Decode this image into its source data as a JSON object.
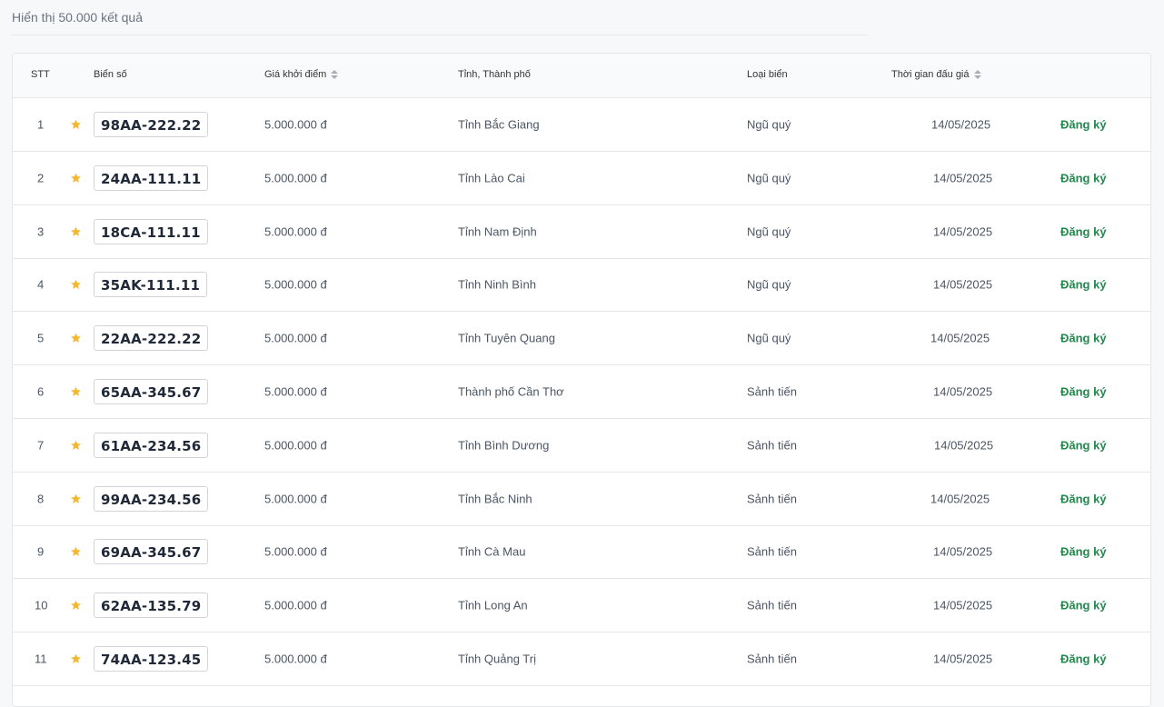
{
  "results": {
    "summary": "Hiển thị 50.000 kết quả"
  },
  "table": {
    "headers": {
      "stt": "STT",
      "plate": "Biển số",
      "price": "Giá khởi điểm",
      "province": "Tỉnh, Thành phố",
      "type": "Loại biển",
      "time": "Thời gian đấu giá"
    },
    "star_color": "#f5b82e",
    "action_color": "#1f8a4c",
    "rows": [
      {
        "stt": "1",
        "plate": "98AA-222.22",
        "price": "5.000.000 đ",
        "province": "Tỉnh Bắc Giang",
        "type": "Ngũ quý",
        "time": "14/05/2025",
        "action": "Đăng ký"
      },
      {
        "stt": "2",
        "plate": "24AA-111.11",
        "price": "5.000.000 đ",
        "province": "Tỉnh Lào Cai",
        "type": "Ngũ quý",
        "time": "14/05/2025",
        "action": "Đăng ký"
      },
      {
        "stt": "3",
        "plate": "18CA-111.11",
        "price": "5.000.000 đ",
        "province": "Tỉnh Nam Định",
        "type": "Ngũ quý",
        "time": "14/05/2025",
        "action": "Đăng ký"
      },
      {
        "stt": "4",
        "plate": "35AK-111.11",
        "price": "5.000.000 đ",
        "province": "Tỉnh Ninh Bình",
        "type": "Ngũ quý",
        "time": "14/05/2025",
        "action": "Đăng ký"
      },
      {
        "stt": "5",
        "plate": "22AA-222.22",
        "price": "5.000.000 đ",
        "province": "Tỉnh Tuyên Quang",
        "type": "Ngũ quý",
        "time": "14/05/2025",
        "action": "Đăng ký"
      },
      {
        "stt": "6",
        "plate": "65AA-345.67",
        "price": "5.000.000 đ",
        "province": "Thành phố Cần Thơ",
        "type": "Sảnh tiến",
        "time": "14/05/2025",
        "action": "Đăng ký"
      },
      {
        "stt": "7",
        "plate": "61AA-234.56",
        "price": "5.000.000 đ",
        "province": "Tỉnh Bình Dương",
        "type": "Sảnh tiến",
        "time": "14/05/2025",
        "action": "Đăng ký"
      },
      {
        "stt": "8",
        "plate": "99AA-234.56",
        "price": "5.000.000 đ",
        "province": "Tỉnh Bắc Ninh",
        "type": "Sảnh tiến",
        "time": "14/05/2025",
        "action": "Đăng ký"
      },
      {
        "stt": "9",
        "plate": "69AA-345.67",
        "price": "5.000.000 đ",
        "province": "Tỉnh Cà Mau",
        "type": "Sảnh tiến",
        "time": "14/05/2025",
        "action": "Đăng ký"
      },
      {
        "stt": "10",
        "plate": "62AA-135.79",
        "price": "5.000.000 đ",
        "province": "Tỉnh Long An",
        "type": "Sảnh tiến",
        "time": "14/05/2025",
        "action": "Đăng ký"
      },
      {
        "stt": "11",
        "plate": "74AA-123.45",
        "price": "5.000.000 đ",
        "province": "Tỉnh Quảng Trị",
        "type": "Sảnh tiến",
        "time": "14/05/2025",
        "action": "Đăng ký"
      }
    ]
  }
}
